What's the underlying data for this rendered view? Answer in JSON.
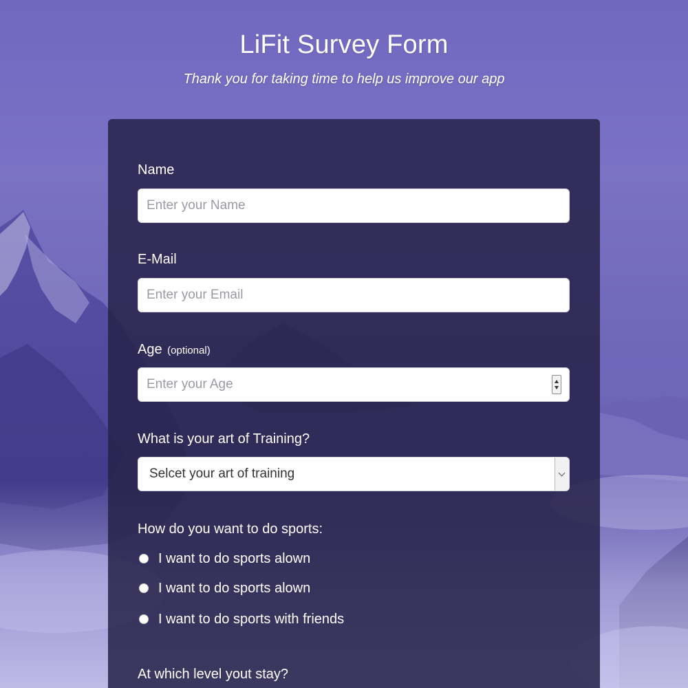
{
  "header": {
    "title": "LiFit Survey Form",
    "subtitle": "Thank you for taking time to help us improve our app"
  },
  "form": {
    "name": {
      "label": "Name",
      "placeholder": "Enter your Name",
      "value": ""
    },
    "email": {
      "label": "E-Mail",
      "placeholder": "Enter your Email",
      "value": ""
    },
    "age": {
      "label": "Age",
      "hint": "(optional)",
      "placeholder": "Enter your Age",
      "value": ""
    },
    "training": {
      "label": "What is your art of Training?",
      "selected": "Selcet your art of training"
    },
    "sports_mode": {
      "label": "How do you want to do sports:",
      "options": [
        "I want to do sports alown",
        "I want to do sports alown",
        "I want to do sports with friends"
      ]
    },
    "level": {
      "label": "At which level yout stay?"
    }
  },
  "colors": {
    "card_background": "#272248",
    "background_top": "#7b72c4",
    "background_bottom": "#6b64b8",
    "text": "#ffffff"
  },
  "icons": {
    "number_stepper": "spin-arrows-icon",
    "select_arrow": "chevron-down-icon",
    "radio": "radio-circle-icon"
  }
}
